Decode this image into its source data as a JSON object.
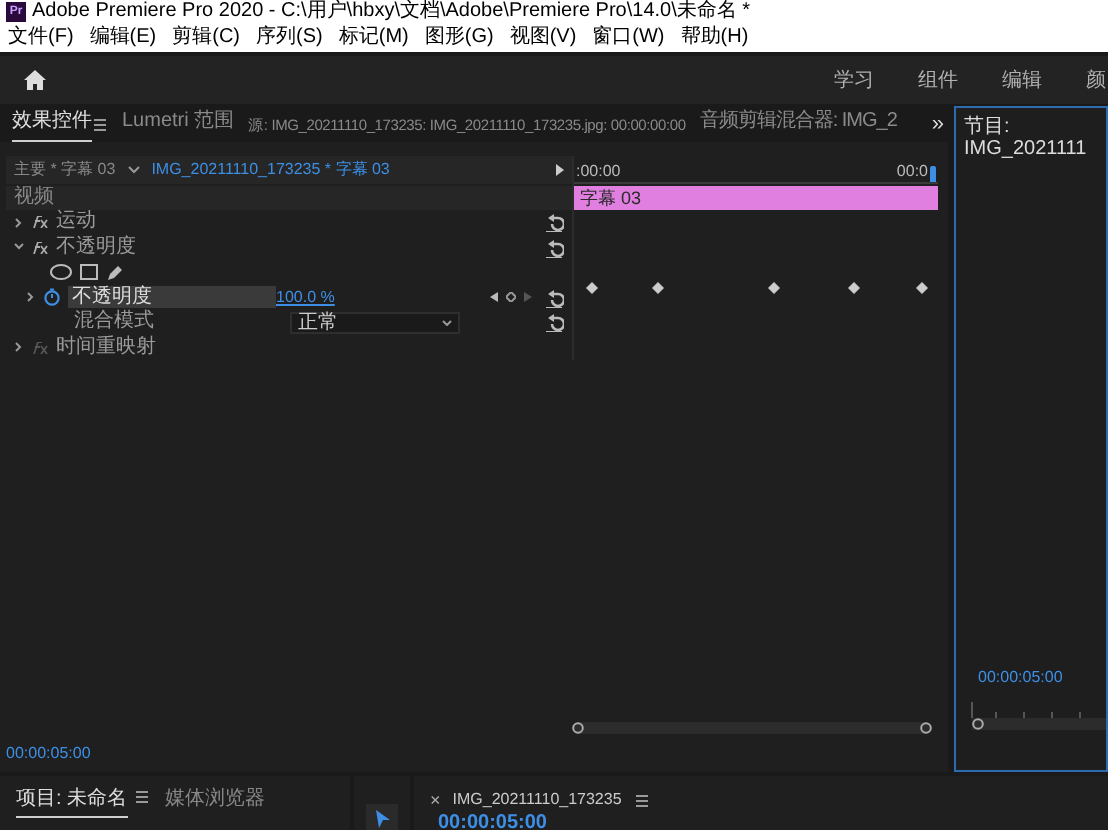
{
  "window": {
    "title": "Adobe Premiere Pro 2020 - C:\\用户\\hbxy\\文档\\Adobe\\Premiere Pro\\14.0\\未命名 *",
    "app_icon": "Pr"
  },
  "menu": [
    "文件(F)",
    "编辑(E)",
    "剪辑(C)",
    "序列(S)",
    "标记(M)",
    "图形(G)",
    "视图(V)",
    "窗口(W)",
    "帮助(H)"
  ],
  "workspaces": [
    "学习",
    "组件",
    "编辑",
    "颜"
  ],
  "panel_tabs": [
    {
      "label": "效果控件",
      "selected": true
    },
    {
      "label": "Lumetri 范围",
      "selected": false
    },
    {
      "label": "源: IMG_20211110_173235: IMG_20211110_173235.jpg: 00:00:00:00",
      "selected": false
    },
    {
      "label": "音频剪辑混合器: IMG_2",
      "selected": false
    }
  ],
  "overflow_tabs": "»",
  "effect_controls": {
    "master": "主要 * 字幕 03",
    "clip": "IMG_20211110_173235 * 字幕 03",
    "section": "视频",
    "effects": [
      {
        "name": "运动",
        "expanded": false,
        "enabled": true
      },
      {
        "name": "不透明度",
        "expanded": true,
        "enabled": true,
        "params": [
          {
            "kind": "masks"
          },
          {
            "kind": "value",
            "name": "不透明度",
            "value": "100.0 %",
            "animated": true,
            "expanded": false
          },
          {
            "kind": "dropdown",
            "name": "混合模式",
            "value": "正常"
          }
        ]
      },
      {
        "name": "时间重映射",
        "expanded": false,
        "enabled": false
      }
    ],
    "timecode": "00:00:05:00"
  },
  "mini_timeline": {
    "start": ":00:00",
    "end": "00:0",
    "clip": "字幕 03"
  },
  "program": {
    "tab": "节目: IMG_2021111",
    "timecode": "00:00:05:00"
  },
  "project_tabs": [
    {
      "label": "项目: 未命名",
      "selected": true
    },
    {
      "label": "媒体浏览器",
      "selected": false
    }
  ],
  "sequence": {
    "close": "×",
    "tab": "IMG_20211110_173235",
    "timecode": "00:00:05:00"
  }
}
